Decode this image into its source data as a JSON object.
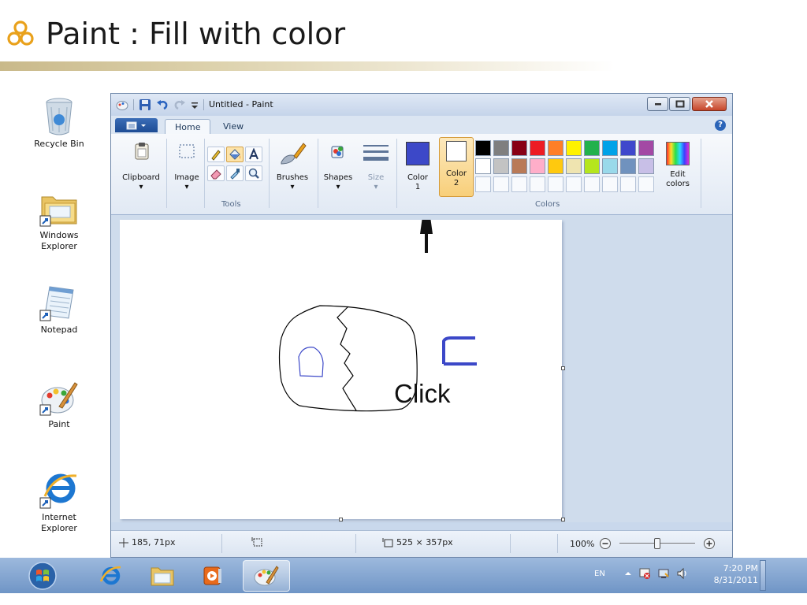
{
  "slide": {
    "title": "Paint : Fill with color"
  },
  "desktop": {
    "icons": [
      {
        "label_lines": [
          "Recycle Bin"
        ]
      },
      {
        "label_lines": [
          "Windows",
          "Explorer"
        ]
      },
      {
        "label_lines": [
          "Notepad"
        ]
      },
      {
        "label_lines": [
          "Paint"
        ]
      },
      {
        "label_lines": [
          "Internet",
          "Explorer"
        ]
      }
    ]
  },
  "window": {
    "title": "Untitled - Paint",
    "tabs": {
      "home": "Home",
      "view": "View"
    },
    "help": "?"
  },
  "ribbon": {
    "clipboard": "Clipboard",
    "image": "Image",
    "tools_group": "Tools",
    "brushes": "Brushes",
    "shapes": "Shapes",
    "size": "Size",
    "color1": [
      "Color",
      "1"
    ],
    "color2": [
      "Color",
      "2"
    ],
    "edit_colors": [
      "Edit",
      "colors"
    ],
    "colors_group": "Colors",
    "active_color1": "#3c48c8",
    "palette_row1": [
      "#000000",
      "#7f7f7f",
      "#880015",
      "#ed1c24",
      "#ff7f27",
      "#fff200",
      "#22b14c",
      "#00a2e8",
      "#3f48cc",
      "#a349a4"
    ],
    "palette_row2": [
      "#ffffff",
      "#c3c3c3",
      "#b97a57",
      "#ffaec9",
      "#ffc90e",
      "#efe4b0",
      "#b5e61d",
      "#99d9ea",
      "#7092be",
      "#c8bfe7"
    ]
  },
  "canvas": {
    "annotation": "Click"
  },
  "status": {
    "cursor_pos": "185, 71px",
    "canvas_size": "525 × 357px",
    "zoom": "100%"
  },
  "taskbar": {
    "lang": "EN",
    "time": "7:20 PM",
    "date": "8/31/2011"
  }
}
